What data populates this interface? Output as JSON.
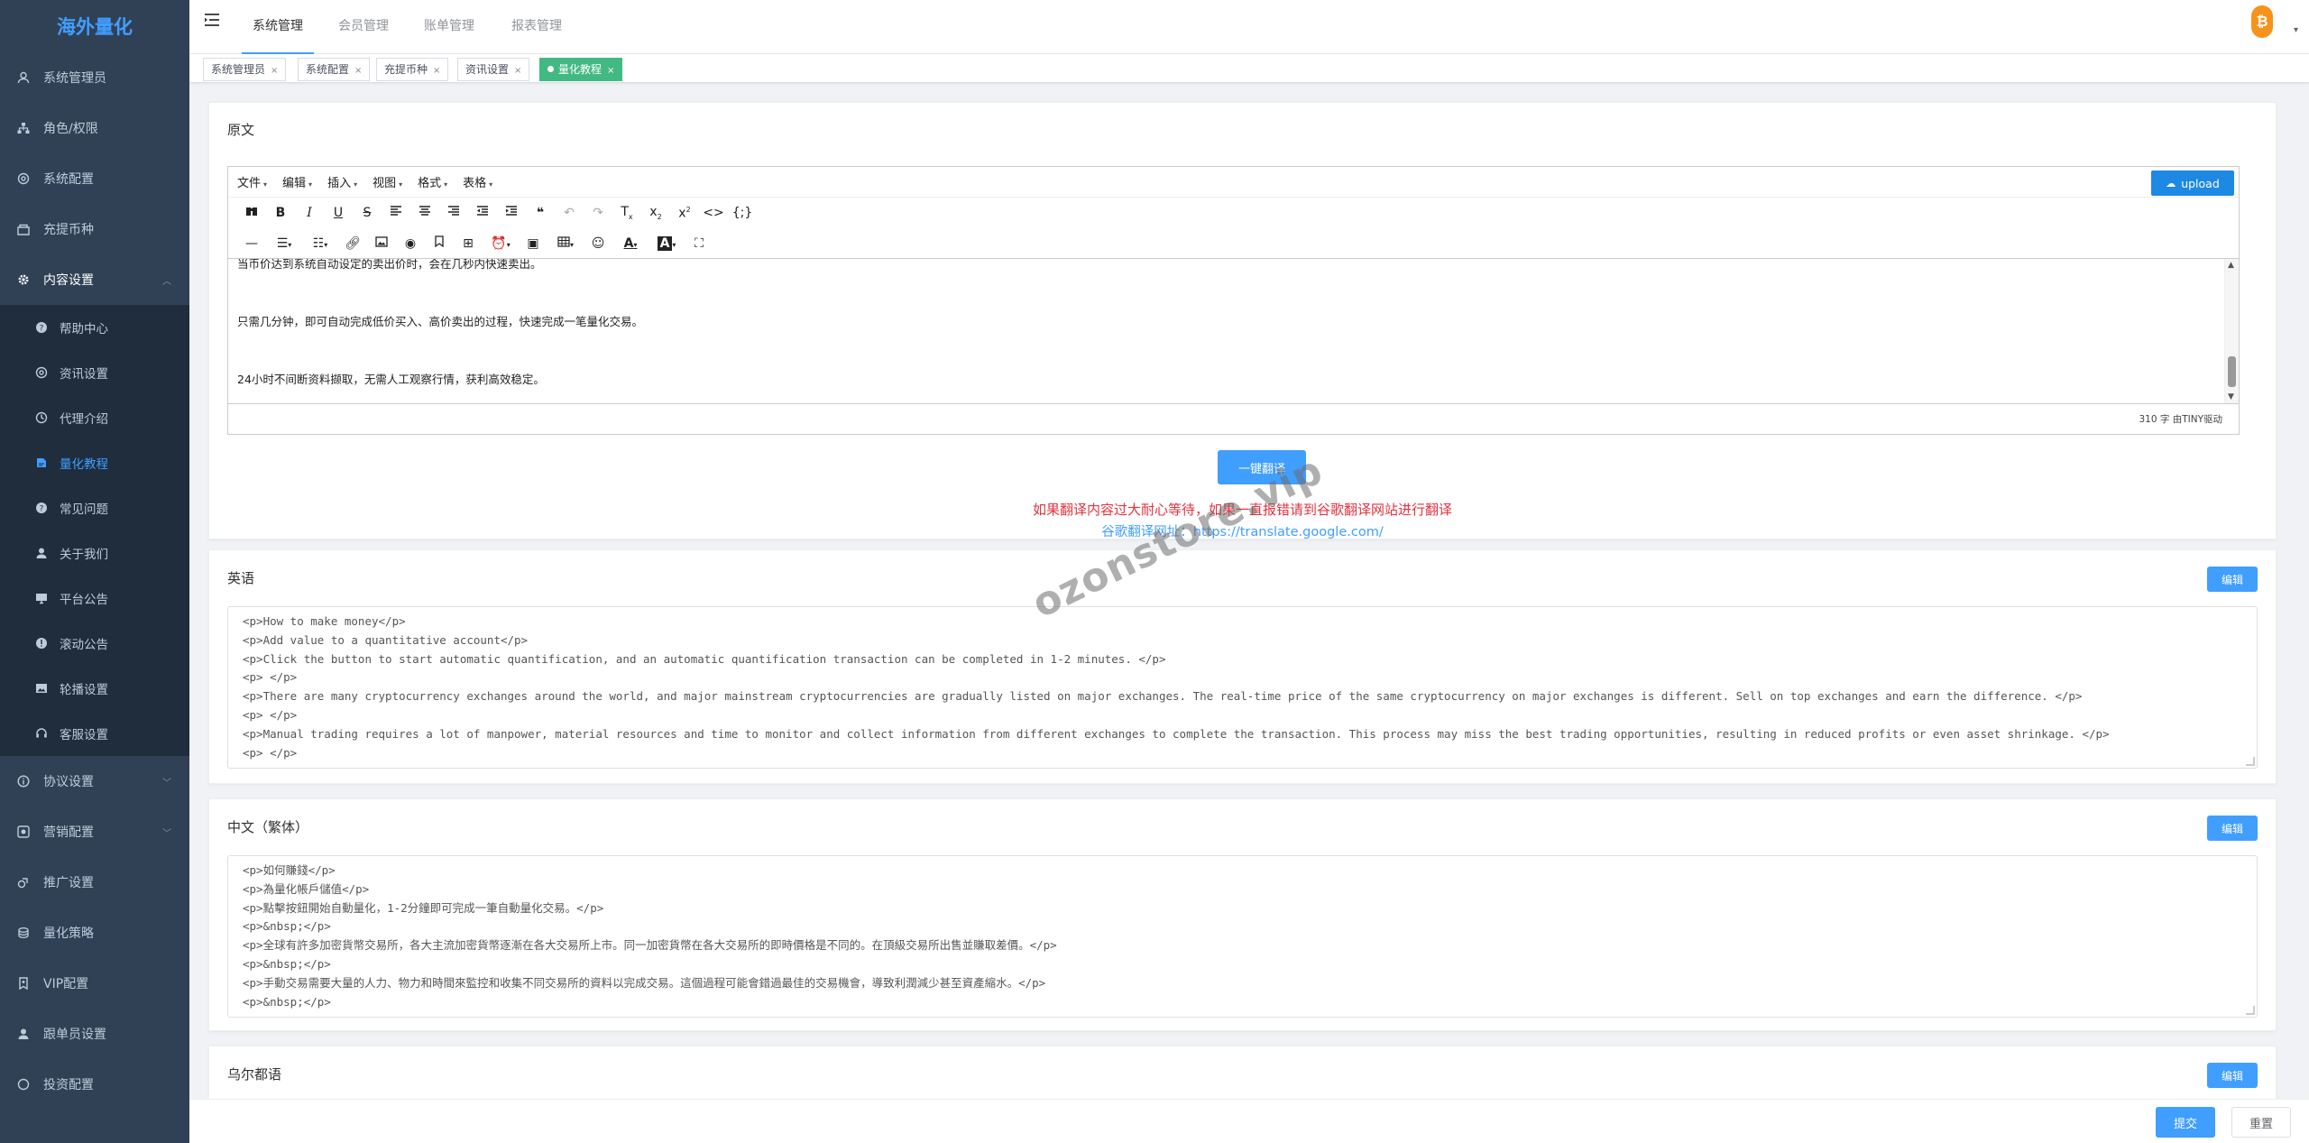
{
  "sidebar": {
    "logo": "海外量化",
    "items": [
      {
        "label": "系统管理员",
        "icon": "user-icon"
      },
      {
        "label": "角色/权限",
        "icon": "org-icon"
      },
      {
        "label": "系统配置",
        "icon": "settings-icon"
      },
      {
        "label": "充提币种",
        "icon": "shop-icon"
      },
      {
        "label": "内容设置",
        "icon": "gear-icon"
      }
    ],
    "content_sub": [
      {
        "label": "帮助中心",
        "icon": "question-icon"
      },
      {
        "label": "资讯设置",
        "icon": "settings-icon"
      },
      {
        "label": "代理介绍",
        "icon": "clock-icon"
      },
      {
        "label": "量化教程",
        "icon": "notebook-icon"
      },
      {
        "label": "常见问题",
        "icon": "question-icon"
      },
      {
        "label": "关于我们",
        "icon": "user-icon"
      },
      {
        "label": "平台公告",
        "icon": "monitor-icon"
      },
      {
        "label": "滚动公告",
        "icon": "info-icon"
      },
      {
        "label": "轮播设置",
        "icon": "picture-icon"
      },
      {
        "label": "客服设置",
        "icon": "headset-icon"
      }
    ],
    "items_after": [
      {
        "label": "协议设置",
        "icon": "info-icon"
      },
      {
        "label": "营销配置",
        "icon": "marketing-icon"
      },
      {
        "label": "推广设置",
        "icon": "share-icon"
      },
      {
        "label": "量化策略",
        "icon": "coins-icon"
      },
      {
        "label": "VIP配置",
        "icon": "vip-icon"
      },
      {
        "label": "跟单员设置",
        "icon": "user-icon"
      },
      {
        "label": "投资配置",
        "icon": "settings-icon"
      }
    ]
  },
  "topbar": {
    "tabs": [
      "系统管理",
      "会员管理",
      "账单管理",
      "报表管理"
    ],
    "active_tab": "系统管理",
    "avatar_symbol": "₿",
    "avatar_color": "#f7931a"
  },
  "tags": [
    {
      "label": "系统管理员"
    },
    {
      "label": "系统配置"
    },
    {
      "label": "充提币种"
    },
    {
      "label": "资讯设置"
    },
    {
      "label": "量化教程",
      "active": true
    }
  ],
  "original": {
    "title": "原文",
    "menu": [
      "文件",
      "编辑",
      "插入",
      "视图",
      "格式",
      "表格"
    ],
    "upload_label": "upload",
    "content": [
      "当币价达到系统自动设定的卖出价时，会在几秒内快速卖出。",
      "只需几分钟，即可自动完成低价买入、高价卖出的过程，快速完成一笔量化交易。",
      "24小时不间断资料撷取，无需人工观察行情，获利高效稳定。"
    ],
    "status": "310 字 由TINY驱动",
    "translate_btn": "一键翻译",
    "warning": "如果翻译内容过大耐心等待，如果一直报错请到谷歌翻译网站进行翻译",
    "google_label": "谷歌翻译网址：",
    "google_url": "https://translate.google.com/"
  },
  "english": {
    "title": "英语",
    "edit_label": "编辑",
    "lines": [
      "<p>How to make money</p>",
      "<p>Add value to a quantitative account</p>",
      "<p>Click the button to start automatic quantification, and an automatic quantification transaction can be completed in 1-2 minutes. </p>",
      "<p> </p>",
      "<p>There are many cryptocurrency exchanges around the world, and major mainstream cryptocurrencies are gradually listed on major exchanges. The real-time price of the same cryptocurrency on major exchanges is different. Sell on top exchanges and earn the difference. </p>",
      "<p> </p>",
      "<p>Manual trading requires a lot of manpower, material resources and time to monitor and collect information from different exchanges to complete the transaction. This process may miss the best trading opportunities, resulting in reduced profits or even asset shrinkage. </p>",
      "<p> </p>"
    ]
  },
  "traditional": {
    "title": "中文（繁体）",
    "edit_label": "编辑",
    "lines": [
      "<p>如何賺錢</p>",
      "<p>為量化帳戶儲值</p>",
      "<p>點擊按鈕開始自動量化，1-2分鐘即可完成一筆自動量化交易。</p>",
      "<p>&nbsp;</p>",
      "<p>全球有許多加密貨幣交易所，各大主流加密貨幣逐漸在各大交易所上市。同一加密貨幣在各大交易所的即時價格是不同的。在頂級交易所出售並賺取差價。</p>",
      "<p>&nbsp;</p>",
      "<p>手動交易需要大量的人力、物力和時間來監控和收集不同交易所的資料以完成交易。這個過程可能會錯過最佳的交易機會，導致利潤減少甚至資產縮水。</p>",
      "<p>&nbsp;</p>"
    ]
  },
  "urdu": {
    "title": "乌尔都语",
    "edit_label": "编辑"
  },
  "watermark": "ozonstore.vip",
  "footer": {
    "submit": "提交",
    "reset": "重置"
  }
}
